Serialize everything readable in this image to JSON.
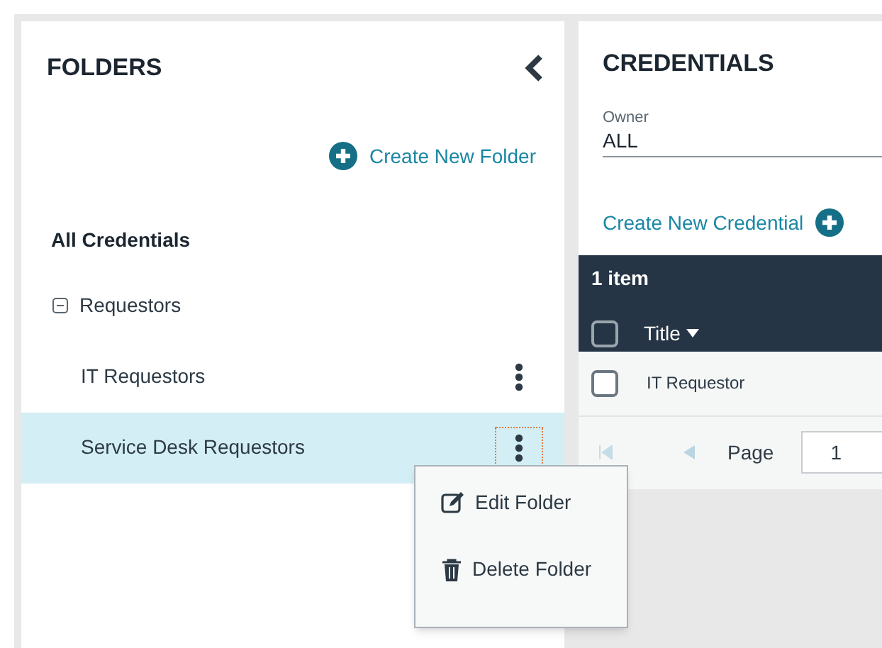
{
  "folders_panel": {
    "title": "FOLDERS",
    "create_link": "Create New Folder",
    "all_label": "All Credentials",
    "tree": [
      {
        "label": "Requestors",
        "expanded": true,
        "selected": false,
        "children": [
          {
            "label": "IT Requestors",
            "selected": false
          },
          {
            "label": "Service Desk Requestors",
            "selected": true
          }
        ]
      }
    ]
  },
  "context_menu": {
    "items": [
      {
        "kind": "edit",
        "label": "Edit Folder"
      },
      {
        "kind": "delete",
        "label": "Delete Folder"
      }
    ]
  },
  "credentials_panel": {
    "title": "CREDENTIALS",
    "owner_field": {
      "label": "Owner",
      "value": "ALL"
    },
    "create_link": "Create New Credential",
    "table": {
      "count": "1 item",
      "header_checked": false,
      "columns": [
        {
          "label": "Title",
          "sort_descending": true
        }
      ],
      "rows": [
        {
          "title": "IT Requestor",
          "checked": false
        }
      ]
    },
    "pager": {
      "first_disabled": true,
      "prev_disabled": true,
      "label": "Page",
      "value": "1"
    }
  }
}
